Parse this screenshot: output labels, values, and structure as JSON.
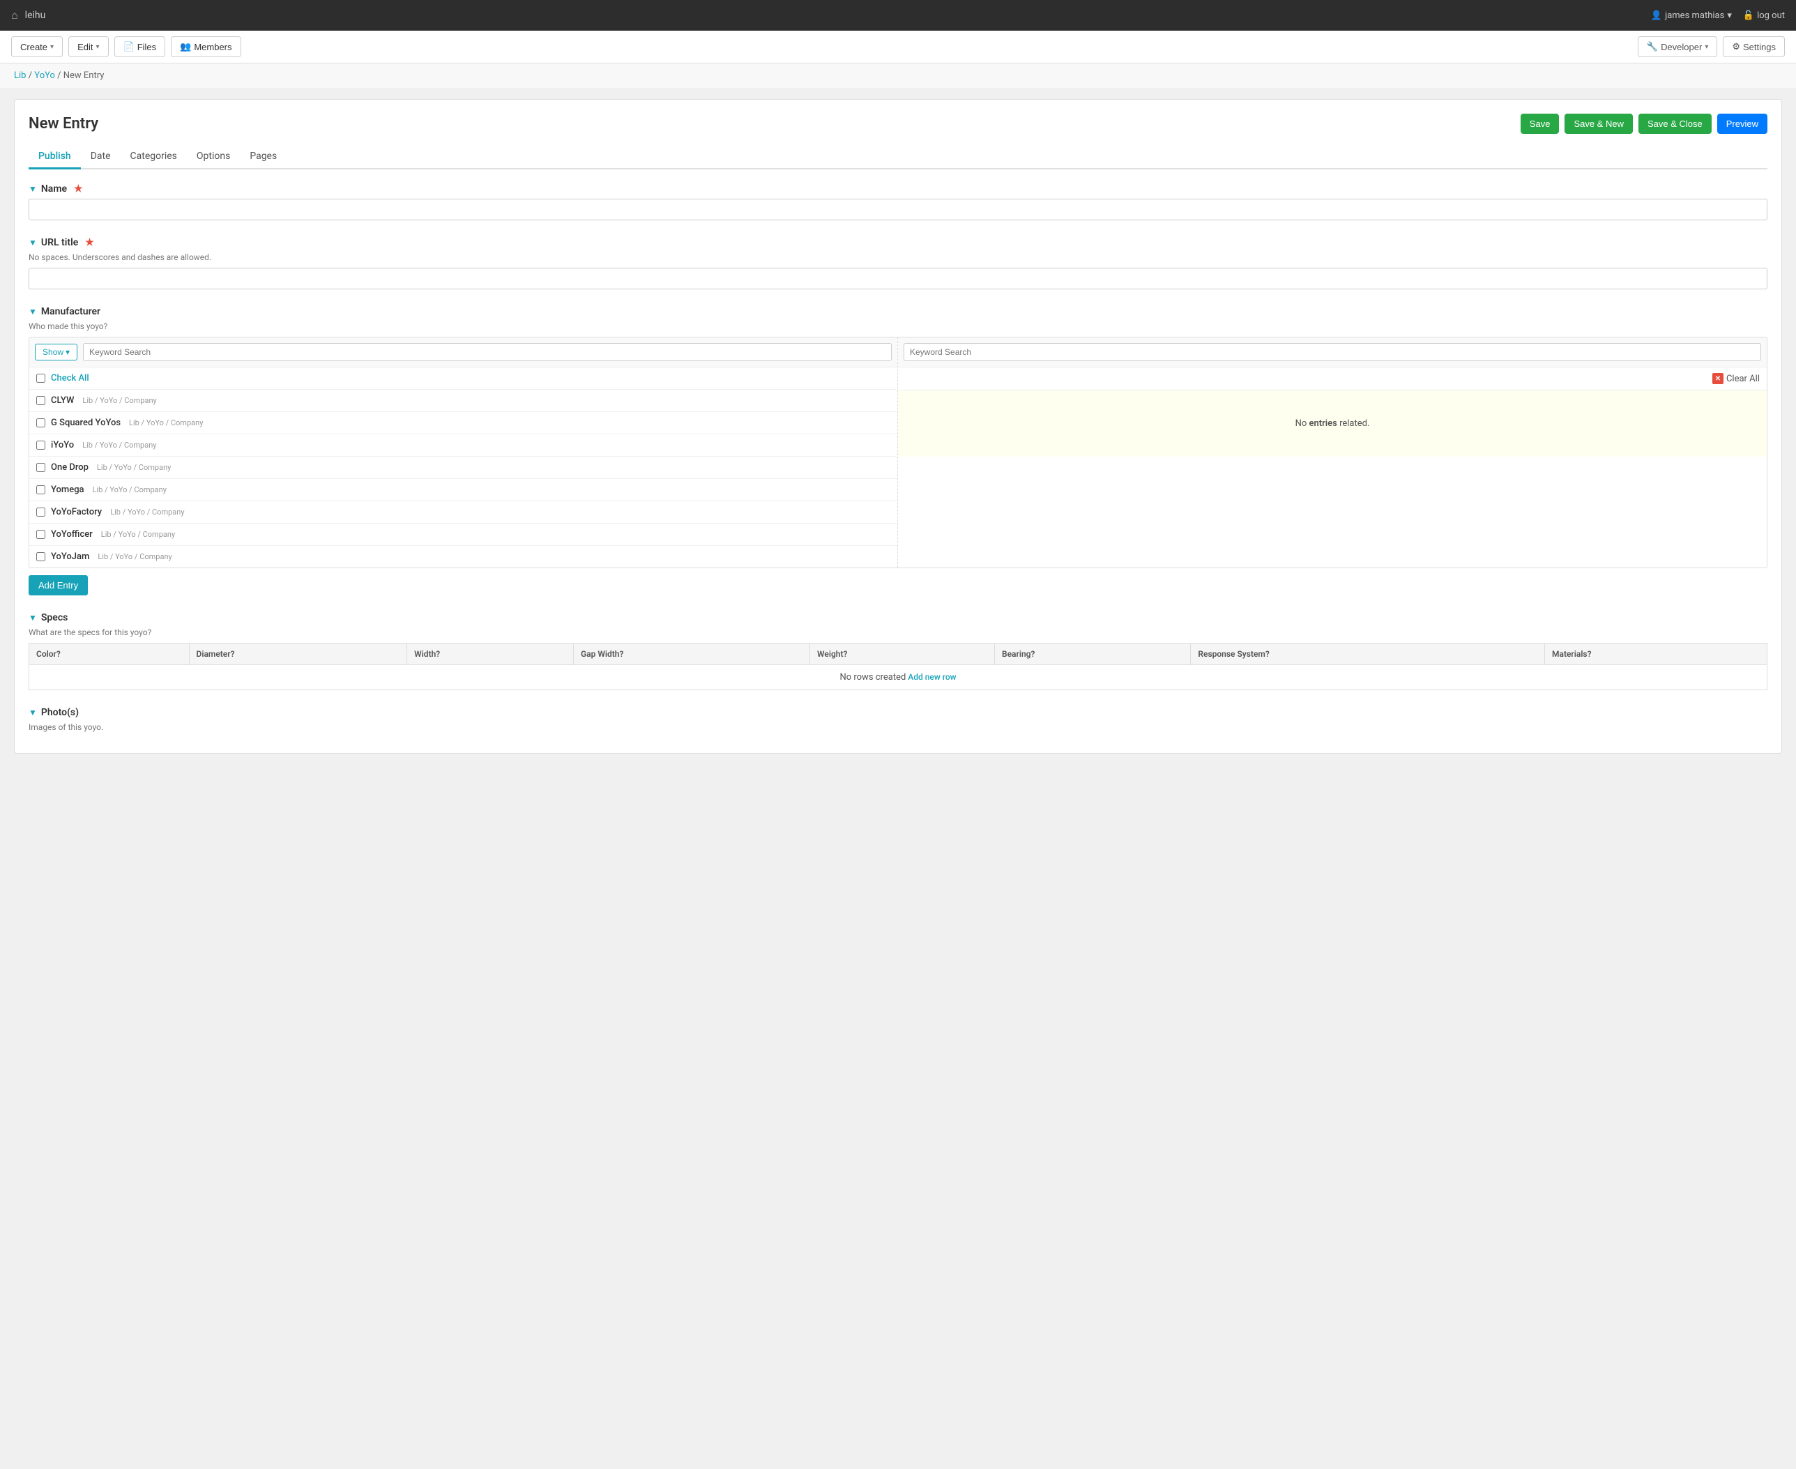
{
  "topNav": {
    "homeIcon": "⌂",
    "siteName": "leihu",
    "user": {
      "icon": "👤",
      "name": "james mathias",
      "chevron": "▾"
    },
    "logout": {
      "icon": "🔓",
      "label": "log out"
    }
  },
  "toolbar": {
    "createLabel": "Create",
    "editLabel": "Edit",
    "filesLabel": "Files",
    "membersLabel": "Members",
    "developerLabel": "Developer",
    "settingsLabel": "Settings"
  },
  "breadcrumb": {
    "lib": "Lib",
    "yoyo": "YoYo",
    "current": "New Entry"
  },
  "entry": {
    "title": "New Entry",
    "actions": {
      "save": "Save",
      "saveNew": "Save & New",
      "saveClose": "Save & Close",
      "preview": "Preview"
    },
    "tabs": [
      {
        "label": "Publish",
        "active": true
      },
      {
        "label": "Date",
        "active": false
      },
      {
        "label": "Categories",
        "active": false
      },
      {
        "label": "Options",
        "active": false
      },
      {
        "label": "Pages",
        "active": false
      }
    ],
    "sections": {
      "name": {
        "label": "Name",
        "required": true,
        "placeholder": ""
      },
      "urlTitle": {
        "label": "URL title",
        "required": true,
        "hint": "No spaces. Underscores and dashes are allowed.",
        "placeholder": ""
      },
      "manufacturer": {
        "label": "Manufacturer",
        "hint": "Who made this yoyo?",
        "left": {
          "showLabel": "Show",
          "keywordPlaceholder": "Keyword Search",
          "checkAllLabel": "Check All",
          "items": [
            {
              "name": "CLYW",
              "path": "Lib / YoYo / Company"
            },
            {
              "name": "G Squared YoYos",
              "path": "Lib / YoYo / Company"
            },
            {
              "name": "iYoYo",
              "path": "Lib / YoYo / Company"
            },
            {
              "name": "One Drop",
              "path": "Lib / YoYo / Company"
            },
            {
              "name": "Yomega",
              "path": "Lib / YoYo / Company"
            },
            {
              "name": "YoYoFactory",
              "path": "Lib / YoYo / Company"
            },
            {
              "name": "YoYofficer",
              "path": "Lib / YoYo / Company"
            },
            {
              "name": "YoYoJam",
              "path": "Lib / YoYo / Company"
            }
          ]
        },
        "right": {
          "keywordPlaceholder": "Keyword Search",
          "clearAllLabel": "Clear All",
          "noEntriesText": "No entries related.",
          "noEntriesStrong": "entries"
        },
        "addEntryLabel": "Add Entry"
      },
      "specs": {
        "label": "Specs",
        "hint": "What are the specs for this yoyo?",
        "columns": [
          "Color?",
          "Diameter?",
          "Width?",
          "Gap Width?",
          "Weight?",
          "Bearing?",
          "Response System?",
          "Materials?"
        ],
        "noRowsText": "No rows created",
        "addNewRowLabel": "Add new row"
      },
      "photos": {
        "label": "Photo(s)",
        "hint": "Images of this yoyo."
      }
    }
  }
}
